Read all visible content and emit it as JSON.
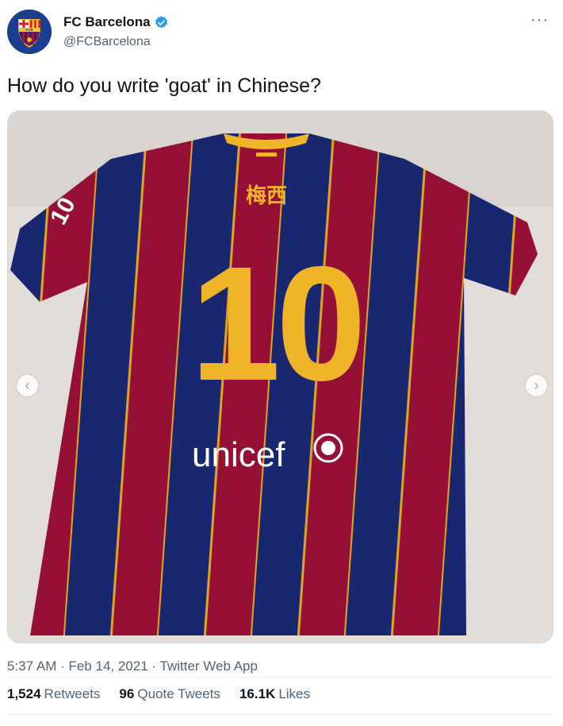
{
  "author": {
    "display_name": "FC Barcelona",
    "handle": "@FCBarcelona",
    "verified": true,
    "avatar_icon": "fc-barcelona-crest-icon",
    "avatar_text": "FCB"
  },
  "more_icon": "more-options-icon",
  "more_label": "···",
  "tweet": {
    "text": "How do you write 'goat' in Chinese?"
  },
  "media": {
    "jersey_name": "梅西",
    "jersey_number": "10",
    "sleeve_number": "10",
    "sponsor": "unicef",
    "nav_prev": "‹",
    "nav_next": "›"
  },
  "meta": {
    "time": "5:37 AM",
    "date": "Feb 14, 2021",
    "source": "Twitter Web App",
    "separator": " · "
  },
  "stats": {
    "retweets_count": "1,524",
    "retweets_label": "Retweets",
    "quotes_count": "96",
    "quotes_label": "Quote Tweets",
    "likes_count": "16.1K",
    "likes_label": "Likes"
  },
  "colors": {
    "blaugrana_blue": "#1c2a7a",
    "blaugrana_red": "#a3123a",
    "gold": "#f0b428",
    "verified_blue": "#1d9bf0"
  }
}
